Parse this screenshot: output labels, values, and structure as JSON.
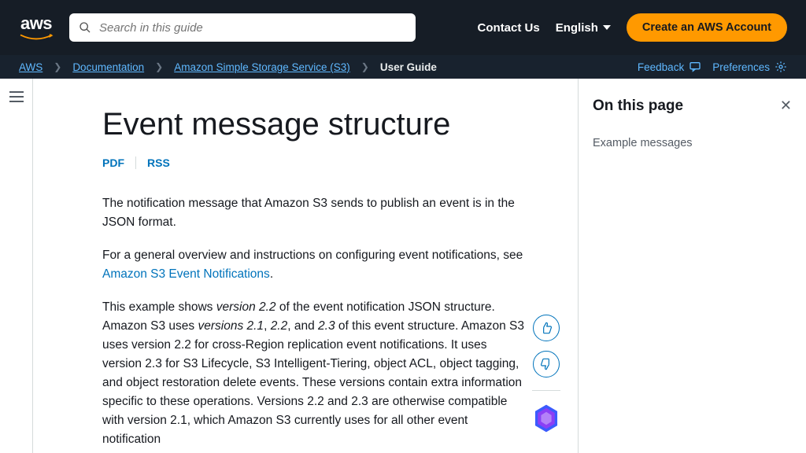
{
  "topbar": {
    "search_placeholder": "Search in this guide",
    "contact": "Contact Us",
    "language": "English",
    "create_account": "Create an AWS Account"
  },
  "breadcrumbs": {
    "items": [
      "AWS",
      "Documentation",
      "Amazon Simple Storage Service (S3)",
      "User Guide"
    ],
    "feedback": "Feedback",
    "preferences": "Preferences"
  },
  "page": {
    "title": "Event message structure",
    "pdf": "PDF",
    "rss": "RSS",
    "para1": "The notification message that Amazon S3 sends to publish an event is in the JSON format.",
    "para2_a": "For a general overview and instructions on configuring event notifications, see ",
    "para2_link": "Amazon S3 Event Notifications",
    "para2_b": ".",
    "para3_a": "This example shows ",
    "para3_v22": "version 2.2",
    "para3_b": " of the event notification JSON structure. Amazon S3 uses ",
    "para3_v21": "versions 2.1",
    "para3_c": ", ",
    "para3_v22b": "2.2",
    "para3_d": ", and ",
    "para3_v23": "2.3",
    "para3_e": " of this event structure. Amazon S3 uses version 2.2 for cross-Region replication event notifications. It uses version 2.3 for S3 Lifecycle, S3 Intelligent-Tiering, object ACL, object tagging, and object restoration delete events. These versions contain extra information specific to these operations. Versions 2.2 and 2.3 are otherwise compatible with version 2.1, which Amazon S3 currently uses for all other event notification"
  },
  "toc": {
    "heading": "On this page",
    "item1": "Example messages"
  }
}
